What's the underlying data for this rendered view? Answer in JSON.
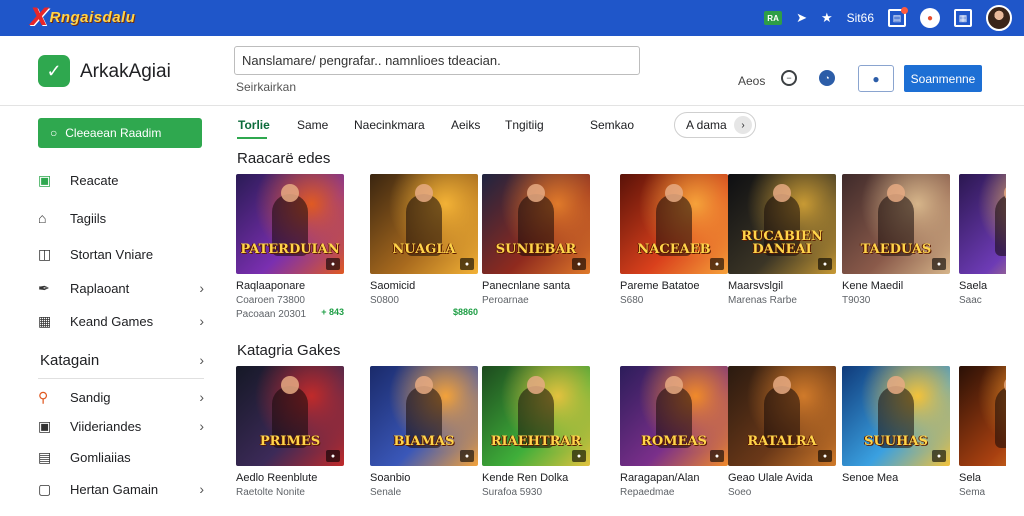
{
  "topbar": {
    "brand_mark": "X",
    "brand_text": "Rngaisdalu",
    "badge": "RA",
    "status_text": "Sit66",
    "avatar": "user-avatar"
  },
  "header": {
    "app_title": "ArkakAgiai",
    "search_value": "Nanslamare/ pengrafar.. namnlioes tdeacian.",
    "search_sub": "Seirkairkan",
    "link": "Aeos",
    "primary_button": "Soanmenne"
  },
  "sidebar": {
    "primary_button": "Cleeaean Raadim",
    "items": [
      {
        "label": "Reacate",
        "icon": "store-icon",
        "chevron": false
      },
      {
        "label": "Tagiils",
        "icon": "home-icon",
        "chevron": false
      },
      {
        "label": "Stortan Vniare",
        "icon": "window-icon",
        "chevron": false
      },
      {
        "label": "Raplaoant",
        "icon": "wrench-icon",
        "chevron": true
      },
      {
        "label": "Keand Games",
        "icon": "map-icon",
        "chevron": true
      }
    ],
    "section_heading": "Katagain",
    "section_items": [
      {
        "label": "Sandig",
        "icon": "search-icon",
        "chevron": true
      },
      {
        "label": "Viideriandes",
        "icon": "tablet-icon",
        "chevron": true
      },
      {
        "label": "Gomliaiias",
        "icon": "laptop-icon",
        "chevron": false
      },
      {
        "label": "Hertan Gamain",
        "icon": "square-icon",
        "chevron": true
      }
    ]
  },
  "tabs": {
    "items": [
      "Torlie",
      "Same",
      "Naecinkmara",
      "Aeiks",
      "Tngitiig",
      "Semkao"
    ],
    "active_index": 0,
    "pill": "A dama"
  },
  "sections": [
    {
      "title": "Raacarë edes",
      "cards": [
        {
          "art_title": "PATERDUIAN",
          "name": "Raqlaaponare",
          "meta": "Coaroen 73800",
          "meta2": "Pacoaan 20301",
          "price": "+ 843",
          "colors": [
            "#2a1b55",
            "#7a2fb0",
            "#e05a22"
          ]
        },
        {
          "art_title": "NUAGLA",
          "name": "Saomicid",
          "meta": "S0800",
          "meta2": "",
          "price": "$8860",
          "colors": [
            "#3a2510",
            "#a86a1e",
            "#f3b236"
          ]
        },
        {
          "art_title": "SUNIEBAR",
          "name": "Panecnlane santa",
          "meta": "Peroarnae",
          "meta2": "",
          "price": "",
          "colors": [
            "#1f2440",
            "#8f2a1e",
            "#e07a2a"
          ]
        },
        {
          "art_title": "NACEAEB",
          "name": "Pareme Batatoe",
          "meta": "S680",
          "meta2": "",
          "price": "",
          "colors": [
            "#5a1208",
            "#d9401c",
            "#f6a23a"
          ]
        },
        {
          "art_title": "RUCABIEN DANEAI",
          "name": "Maarsvslgil",
          "meta": "Marenas Rarbe",
          "meta2": "",
          "price": "",
          "colors": [
            "#0e0f12",
            "#3b3526",
            "#c89a34"
          ]
        },
        {
          "art_title": "TAEDUAS",
          "name": "Kene Maedil",
          "meta": "T9030",
          "meta2": "",
          "price": "",
          "colors": [
            "#3e2a2a",
            "#8a5a4a",
            "#d6b58a"
          ]
        },
        {
          "art_title": "",
          "name": "Saela",
          "meta": "Saac",
          "meta2": "",
          "price": "",
          "colors": [
            "#2b1750",
            "#6d3bb5",
            "#f2c04e"
          ]
        }
      ]
    },
    {
      "title": "Katagria Gakes",
      "cards": [
        {
          "art_title": "PRIMES",
          "name": "Aedlo Reenblute",
          "meta": "Raetolte Nonite",
          "meta2": "",
          "price": "",
          "colors": [
            "#151826",
            "#3c2a58",
            "#c02a2a"
          ]
        },
        {
          "art_title": "BIAMAS",
          "name": "Soanbio",
          "meta": "Senale",
          "meta2": "",
          "price": "",
          "colors": [
            "#1a2a6a",
            "#3a57b8",
            "#f3a23a"
          ]
        },
        {
          "art_title": "RIAEHTRAR",
          "name": "Kende Ren Dolka",
          "meta": "Surafoa 5930",
          "meta2": "",
          "price": "",
          "colors": [
            "#1d4a1e",
            "#3fae3a",
            "#e3c23e"
          ]
        },
        {
          "art_title": "ROMEAS",
          "name": "Raragapan/Alan",
          "meta": "Repaedmae",
          "meta2": "",
          "price": "",
          "colors": [
            "#2c1d5a",
            "#7a2f8a",
            "#f08a2a"
          ]
        },
        {
          "art_title": "RATALRA",
          "name": "Geao Ulale Avida",
          "meta": "Soeo",
          "meta2": "",
          "price": "",
          "colors": [
            "#2a1a10",
            "#6a3818",
            "#d07a2a"
          ]
        },
        {
          "art_title": "SUUHAS",
          "name": "Senoe Mea",
          "meta": "",
          "meta2": "",
          "price": "",
          "colors": [
            "#0f3a7a",
            "#3aa0e0",
            "#f3c23a"
          ]
        },
        {
          "art_title": "",
          "name": "Sela",
          "meta": "Sema",
          "meta2": "",
          "price": "",
          "colors": [
            "#2a1006",
            "#a84010",
            "#f39a2a"
          ]
        }
      ]
    }
  ],
  "theme": {
    "brand_blue": "#1f56c9",
    "accent_green": "#2fa84f",
    "primary_blue": "#1d6fd4"
  }
}
